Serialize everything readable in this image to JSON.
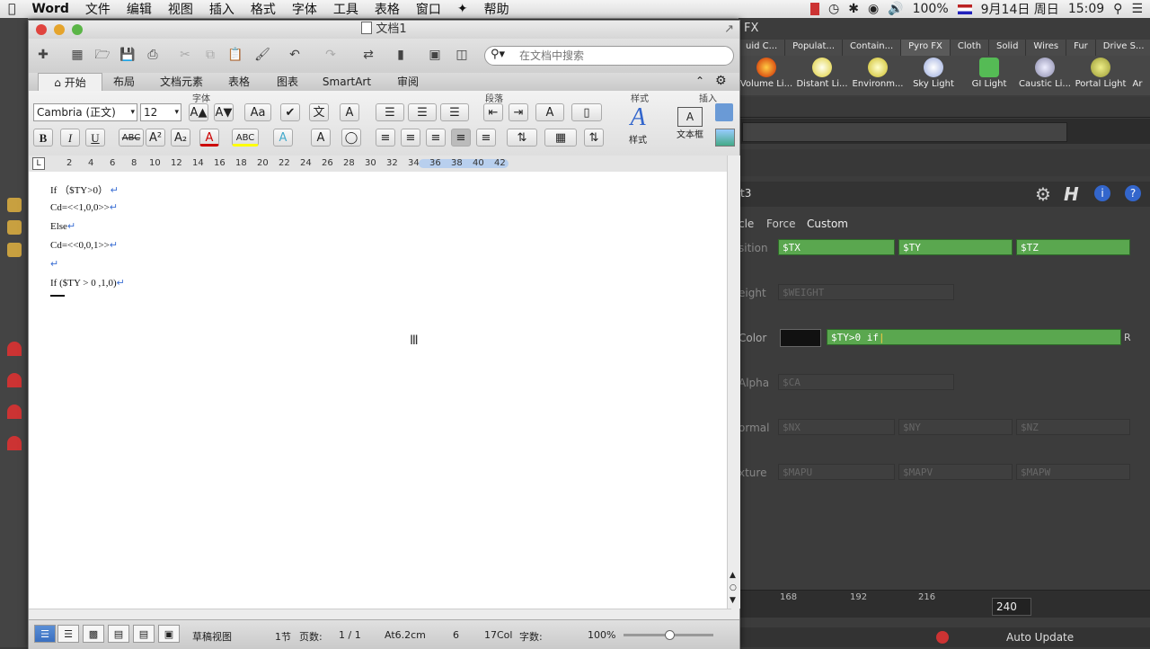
{
  "menubar": {
    "app": "Word",
    "items": [
      "文件",
      "编辑",
      "视图",
      "插入",
      "格式",
      "字体",
      "工具",
      "表格",
      "窗口",
      "帮助"
    ],
    "battery": "100%",
    "date": "9月14日 周日",
    "time": "15:09"
  },
  "houdini": {
    "fx_label": "FX",
    "shelf_tabs": [
      "uid C...",
      "Populat...",
      "Contain...",
      "Pyro FX",
      "Cloth",
      "Solid",
      "Wires",
      "Fur",
      "Drive S..."
    ],
    "shelf_tools": [
      "Volume Li...",
      "Distant Li...",
      "Environm...",
      "Sky Light",
      "GI Light",
      "Caustic Li...",
      "Portal Light",
      "Ar"
    ],
    "node_name": "t3",
    "param_tabs": [
      "cle",
      "Force",
      "Custom"
    ],
    "position_label": "sition",
    "tx": "$TX",
    "ty": "$TY",
    "tz": "$TZ",
    "weight_label": "eight",
    "weight": "$WEIGHT",
    "color_label": "Color",
    "color_expr": "$TY>0 if",
    "alpha_label": "Alpha",
    "alpha": "$CA",
    "normal_label": "ormal",
    "nx": "$NX",
    "ny": "$NY",
    "nz": "$NZ",
    "texture_label": "xture",
    "mapu": "$MAPU",
    "mapv": "$MAPV",
    "mapw": "$MAPW",
    "timeline_ticks": [
      "168",
      "192",
      "216"
    ],
    "frame": "240",
    "auto_update": "Auto Update",
    "color_r": "R"
  },
  "word": {
    "title": "文档1",
    "search_placeholder": "在文档中搜索",
    "tabs": [
      "开始",
      "布局",
      "文档元素",
      "表格",
      "图表",
      "SmartArt",
      "审阅"
    ],
    "groups": {
      "font": "字体",
      "paragraph": "段落",
      "styles": "样式",
      "insert": "插入"
    },
    "font_name": "Cambria (正文)",
    "font_size": "12",
    "styles_label": "样式",
    "textbox_label": "文本框",
    "ruler_numbers": [
      "2",
      "4",
      "6",
      "8",
      "10",
      "12",
      "14",
      "16",
      "18",
      "20",
      "22",
      "24",
      "26",
      "28",
      "30",
      "32",
      "34",
      "36",
      "38",
      "40",
      "42"
    ],
    "doc_lines": [
      "If （$TY>0）",
      "Cd=<<1,0,0>>",
      "Else",
      "Cd=<<0,0,1>>",
      "",
      "If ($TY > 0 ,1,0)"
    ],
    "status": {
      "view": "草稿视图",
      "section": "1节",
      "pages_label": "页数:",
      "pages": "1 / 1",
      "at": "At6.2cm",
      "line": "6",
      "col": "17Col",
      "words_label": "字数:",
      "zoom": "100%"
    }
  }
}
